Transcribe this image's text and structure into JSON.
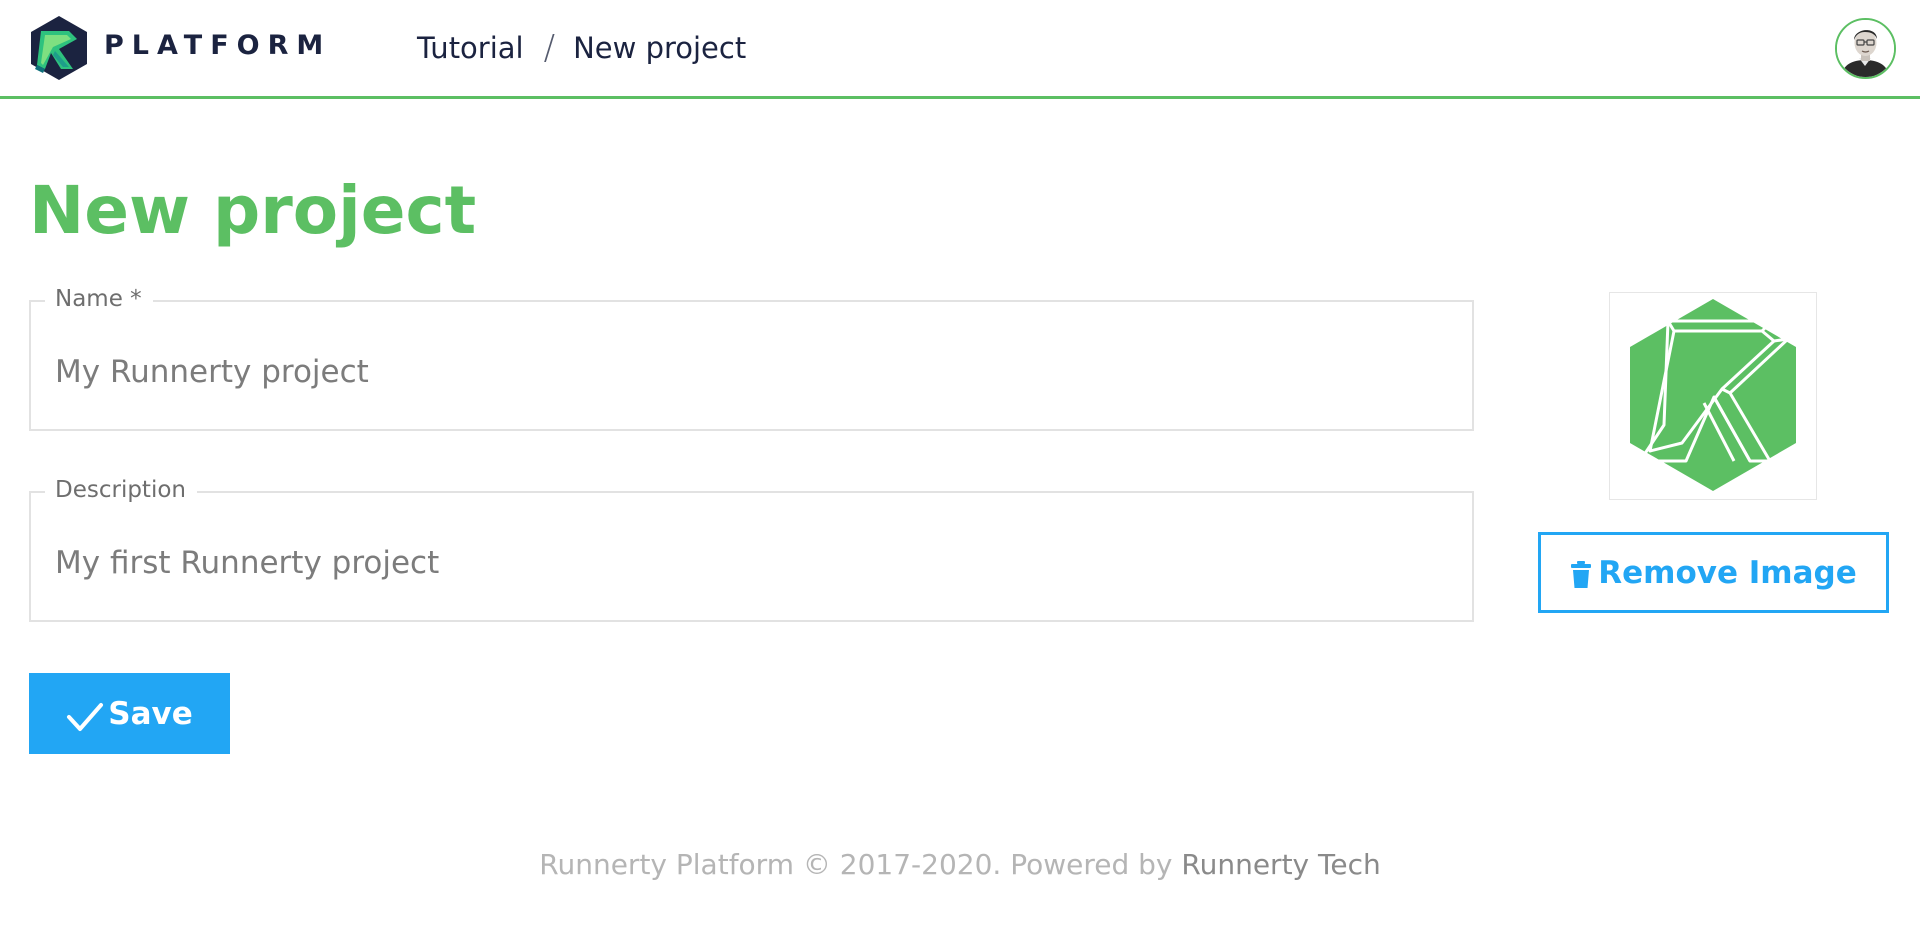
{
  "header": {
    "brand": "PLATFORM",
    "breadcrumb": {
      "parent": "Tutorial",
      "separator": "/",
      "current": "New project"
    }
  },
  "page": {
    "title": "New project"
  },
  "form": {
    "name": {
      "label": "Name *",
      "value": "My Runnerty project"
    },
    "description": {
      "label": "Description",
      "value": "My first Runnerty project"
    },
    "save_label": "Save"
  },
  "image_panel": {
    "remove_label": "Remove Image"
  },
  "footer": {
    "text": "Runnerty Platform © 2017-2020. Powered by",
    "link": "Runnerty Tech"
  },
  "icons": {
    "logo": "runnerty-logo-icon",
    "avatar": "user-avatar-icon",
    "trash": "trash-icon",
    "check": "check-icon"
  },
  "colors": {
    "accent_green": "#5cbf63",
    "accent_blue": "#22a6f4",
    "brand_dark": "#1b2340"
  }
}
